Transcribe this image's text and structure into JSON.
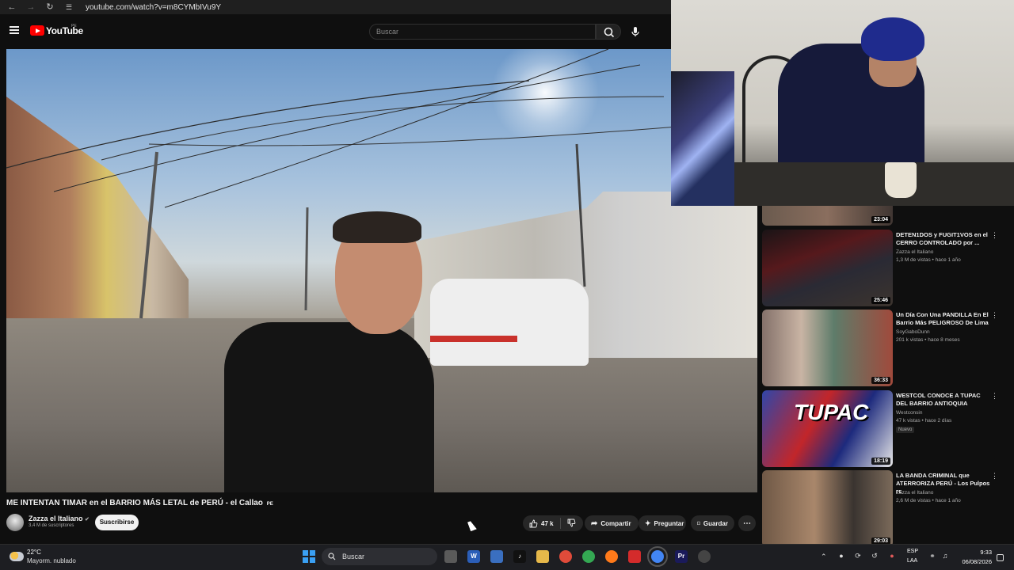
{
  "browser": {
    "url": "youtube.com/watch?v=m8CYMbIVu9Y"
  },
  "header": {
    "wordmark": "YouTube",
    "country": "PE",
    "search_placeholder": "Buscar"
  },
  "video": {
    "title": "ME INTENTAN TIMAR en el BARRIO MÁS LETAL de PERÚ - el Callao",
    "title_country": "PE",
    "channel_name": "Zazza el Italiano",
    "channel_subs": "3,4 M de suscriptores",
    "subscribe_label": "Suscribirse",
    "likes": "47 k",
    "share_label": "Compartir",
    "ask_label": "Preguntar",
    "save_label": "Guardar"
  },
  "sidebar": {
    "items": [
      {
        "duration": "23:04"
      },
      {
        "title": "DETEN1DOS y FUGIT1VOS en el CERRO CONTROLADO por ...",
        "channel": "Zazza el Italiano",
        "meta": "1,3 M de vistas • hace 1 año",
        "duration": "25:46"
      },
      {
        "title": "Un Día Con Una PANDILLA En El Barrio Más PELIGROSO De Lima",
        "channel": "SoyGaboDunn",
        "meta": "201 k vistas • hace 8 meses",
        "duration": "36:33"
      },
      {
        "title": "WESTCOL CONOCE A TUPAC DEL BARRIO ANTIOQUIA",
        "channel": "Westconsin",
        "meta": "47 k vistas • hace 2 días",
        "badge": "Nuevo",
        "duration": "18:19"
      },
      {
        "title": "LA BANDA CRIMINAL que ATERRORIZA PERÚ - Los Pulpos",
        "title_country": "PE",
        "channel": "Zazza el Italiano",
        "meta": "2,6 M de vistas • hace 1 año",
        "duration": "29:03"
      }
    ]
  },
  "thumbnail_text": {
    "tupac": "TUPAC"
  },
  "taskbar": {
    "temperature": "22°C",
    "weather": "Mayorm. nublado",
    "search_label": "Buscar",
    "lang_1": "ESP",
    "lang_2": "LAA",
    "time": "9:33",
    "date": "06/08/2026"
  },
  "colors": {
    "accent_red": "#ff0000",
    "background": "#0f0f0f",
    "pill": "#272727"
  }
}
